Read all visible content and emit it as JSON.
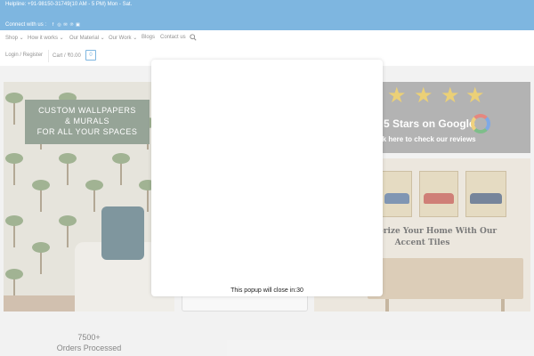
{
  "topbar": {
    "helpline": "Helpline: +91-98150-31749(10 AM - 5 PM) Mon - Sat.",
    "connect_label": "Connect with us :",
    "social_icons": [
      "facebook-icon",
      "instagram-icon",
      "email-icon",
      "pinterest-icon",
      "linkedin-icon"
    ],
    "color": "#3a8fd0"
  },
  "nav": {
    "items": [
      {
        "label": "Shop ⌄"
      },
      {
        "label": "How it works ⌄"
      },
      {
        "label": "Our Material ⌄"
      },
      {
        "label": "Our Work ⌄"
      },
      {
        "label": "Blogs"
      },
      {
        "label": "Contact us"
      }
    ],
    "search_icon": "search-icon"
  },
  "account": {
    "login_label": "Login / Register",
    "cart_label": "Cart / ₹0.00",
    "cart_count": "0"
  },
  "banners": {
    "left_title_lines": [
      "CUSTOM WALLPAPERS",
      "& MURALS",
      "FOR ALL YOUR SPACES"
    ],
    "review_stars": 4,
    "review_line1": "r 5 Stars on Google",
    "review_line2": "ick here to check our reviews",
    "tiles_line1": "Accessorize Your Home With Our",
    "tiles_line2": "Accent Tiles"
  },
  "stats": {
    "orders_value": "7500+",
    "orders_label": "Orders Processed"
  },
  "popup": {
    "closing_text": "This popup will close in:30"
  }
}
